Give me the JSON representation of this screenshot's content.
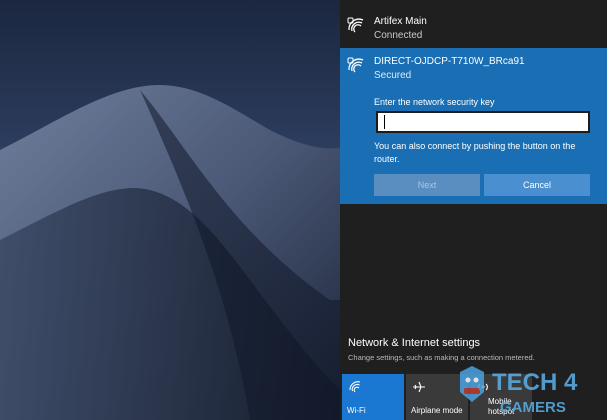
{
  "network_list": [
    {
      "name": "Artifex Main",
      "status": "Connected"
    },
    {
      "name": "DIRECT-OJDCP-T710W_BRca91",
      "status": "Secured"
    }
  ],
  "connect_form": {
    "prompt": "Enter the network security key",
    "key_value": "",
    "hint": "You can also connect by pushing the button on the router.",
    "next_label": "Next",
    "cancel_label": "Cancel"
  },
  "settings": {
    "title": "Network & Internet settings",
    "subtitle": "Change settings, such as making a connection metered."
  },
  "quick_actions": {
    "wifi_label": "Wi-Fi",
    "airplane_label": "Airplane mode",
    "hotspot_label_line1": "Mobile",
    "hotspot_label_line2": "hotspot"
  },
  "watermark": {
    "line1": "TECH 4",
    "line2": "GAMERS"
  },
  "icons": {
    "wifi": "wifi-secured-icon",
    "airplane": "airplane-icon",
    "hotspot": "mobile-hotspot-icon"
  },
  "colors": {
    "accent": "#1a6fb4",
    "flyout_bg": "#1f1f1f",
    "wifi_tile": "#1a78d2"
  }
}
